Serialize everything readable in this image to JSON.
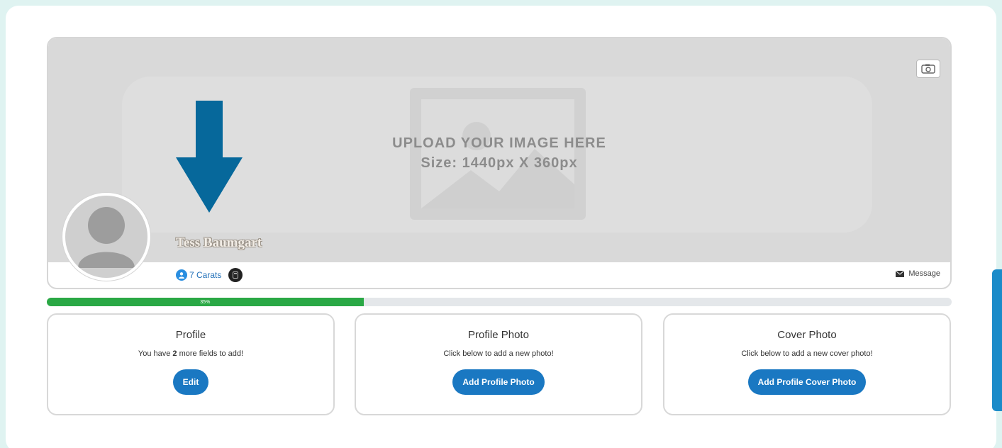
{
  "cover": {
    "upload_line1": "UPLOAD YOUR IMAGE HERE",
    "upload_line2": "Size: 1440px X 360px"
  },
  "profile": {
    "name": "Tess Baumgart",
    "carats": "7 Carats",
    "message_label": "Message"
  },
  "progress": {
    "label": "35%",
    "value": 35
  },
  "cards": [
    {
      "title": "Profile",
      "desc_before": "You have ",
      "desc_bold": "2",
      "desc_after": " more fields to add!",
      "button": "Edit"
    },
    {
      "title": "Profile Photo",
      "desc": "Click below to add a new photo!",
      "button": "Add Profile Photo"
    },
    {
      "title": "Cover Photo",
      "desc": "Click below to add a new cover photo!",
      "button": "Add Profile Cover Photo"
    }
  ],
  "colors": {
    "accent_blue": "#1a78c2",
    "progress_green": "#2aa845",
    "arrow_blue": "#06689b"
  },
  "icons": [
    "camera-icon",
    "user-icon",
    "badge-icon",
    "envelope-icon",
    "image-placeholder-icon",
    "avatar-placeholder-icon",
    "arrow-down-icon"
  ]
}
